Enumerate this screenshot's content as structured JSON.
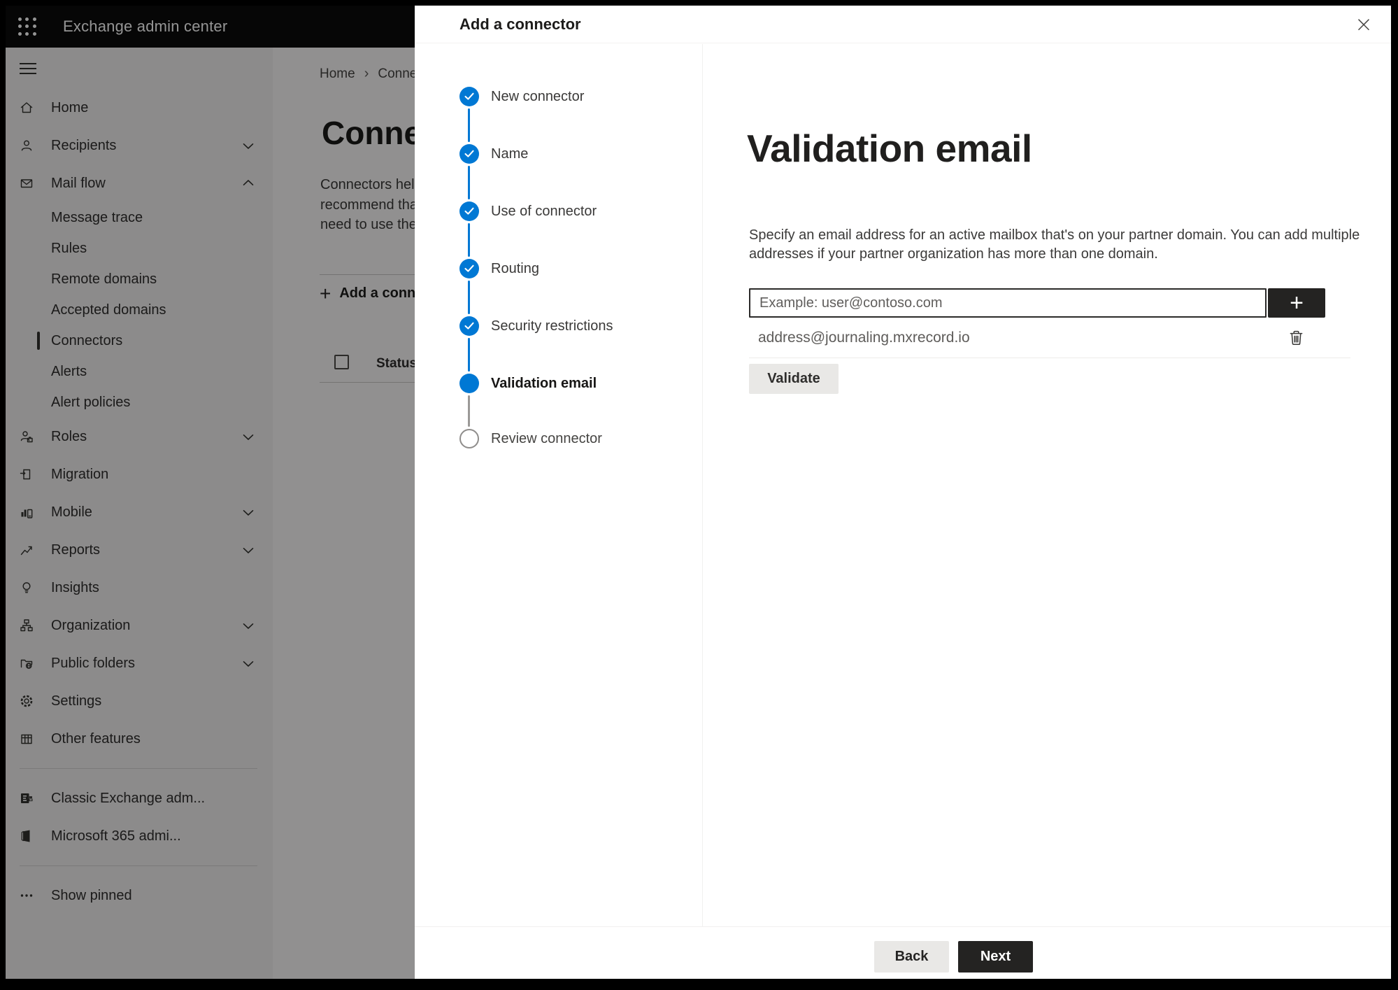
{
  "topbar": {
    "title": "Exchange admin center"
  },
  "sidebar": {
    "items": [
      {
        "label": "Home",
        "icon": "home",
        "type": "top"
      },
      {
        "label": "Recipients",
        "icon": "person",
        "type": "top",
        "chevron": "down"
      },
      {
        "label": "Mail flow",
        "icon": "mail",
        "type": "top",
        "chevron": "up"
      },
      {
        "label": "Message trace",
        "type": "sub"
      },
      {
        "label": "Rules",
        "type": "sub"
      },
      {
        "label": "Remote domains",
        "type": "sub"
      },
      {
        "label": "Accepted domains",
        "type": "sub"
      },
      {
        "label": "Connectors",
        "type": "sub",
        "selected": true
      },
      {
        "label": "Alerts",
        "type": "sub"
      },
      {
        "label": "Alert policies",
        "type": "sub"
      },
      {
        "label": "Roles",
        "icon": "roles",
        "type": "top",
        "chevron": "down"
      },
      {
        "label": "Migration",
        "icon": "migration",
        "type": "top"
      },
      {
        "label": "Mobile",
        "icon": "mobile",
        "type": "top",
        "chevron": "down"
      },
      {
        "label": "Reports",
        "icon": "reports",
        "type": "top",
        "chevron": "down"
      },
      {
        "label": "Insights",
        "icon": "insights",
        "type": "top"
      },
      {
        "label": "Organization",
        "icon": "organization",
        "type": "top",
        "chevron": "down"
      },
      {
        "label": "Public folders",
        "icon": "public-folders",
        "type": "top",
        "chevron": "down"
      },
      {
        "label": "Settings",
        "icon": "settings",
        "type": "top"
      },
      {
        "label": "Other features",
        "icon": "other-features",
        "type": "top"
      },
      {
        "divider": true
      },
      {
        "label": "Classic Exchange adm...",
        "icon": "classic-exchange",
        "type": "top"
      },
      {
        "label": "Microsoft 365 admi...",
        "icon": "m365",
        "type": "top"
      },
      {
        "divider": true
      },
      {
        "label": "Show pinned",
        "icon": "ellipsis",
        "type": "top"
      }
    ]
  },
  "background_page": {
    "breadcrumb": {
      "home": "Home",
      "separator": "›",
      "current": "Connectors"
    },
    "title": "Connectors",
    "description_visible": "Connectors help\nrecommend that\nneed to use ther",
    "add_button_label": "Add a connector",
    "table": {
      "status_header": "Status"
    }
  },
  "panel": {
    "title": "Add a connector",
    "close_label": "×",
    "steps": [
      {
        "label": "New connector",
        "state": "done"
      },
      {
        "label": "Name",
        "state": "done"
      },
      {
        "label": "Use of connector",
        "state": "done"
      },
      {
        "label": "Routing",
        "state": "done"
      },
      {
        "label": "Security restrictions",
        "state": "done"
      },
      {
        "label": "Validation email",
        "state": "current"
      },
      {
        "label": "Review connector",
        "state": "upcoming"
      }
    ],
    "content": {
      "heading": "Validation email",
      "description": "Specify an email address for an active mailbox that's on your partner domain. You can add multiple addresses if your partner organization has more than one domain.",
      "email_input": {
        "value": "",
        "placeholder": "Example: user@contoso.com"
      },
      "add_address_label": "+",
      "addresses": [
        "address@journaling.mxrecord.io"
      ],
      "validate_button": "Validate"
    },
    "footer": {
      "back_button": "Back",
      "next_button": "Next"
    }
  },
  "colors": {
    "accent": "#0078d4",
    "dark_button": "#242322",
    "light_button": "#e9e8e6",
    "overlay": "rgba(0,0,0,0.42)",
    "topbar_bg": "#0b0b0b"
  }
}
